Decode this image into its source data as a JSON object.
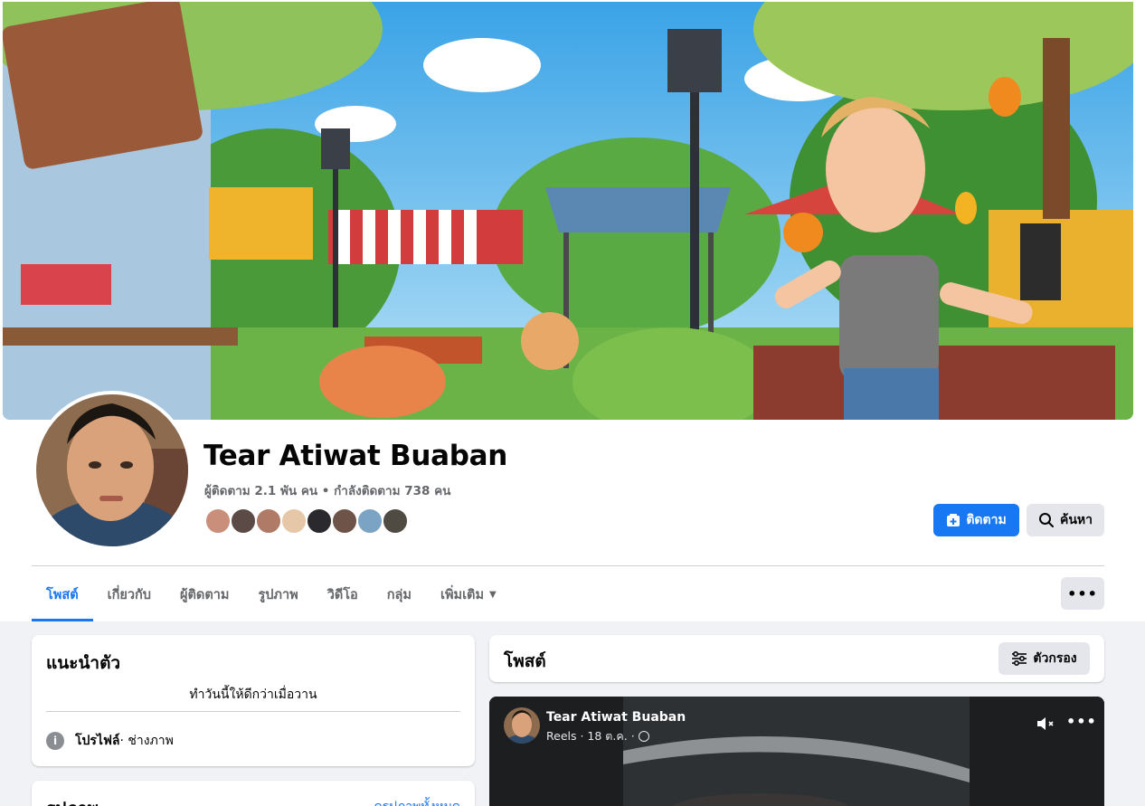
{
  "profile": {
    "name": "Tear Atiwat Buaban",
    "stats": "ผู้ติดตาม 2.1 พัน คน • กำลังติดตาม 738 คน",
    "follow_label": "ติดตาม",
    "search_label": "ค้นหา"
  },
  "tabs": [
    {
      "label": "โพสต์"
    },
    {
      "label": "เกี่ยวกับ"
    },
    {
      "label": "ผู้ติดตาม"
    },
    {
      "label": "รูปภาพ"
    },
    {
      "label": "วิดีโอ"
    },
    {
      "label": "กลุ่ม"
    },
    {
      "label": "เพิ่มเติม"
    }
  ],
  "more_menu_label": "•••",
  "intro": {
    "title": "แนะนำตัว",
    "bio": "ทำวันนี้ให้ดีกว่าเมื่อวาน",
    "info_label": "โปรไฟล์",
    "info_detail": " · ช่างภาพ"
  },
  "photos": {
    "title": "รูปภาพ",
    "see_all": "ดูรูปภาพทั้งหมด"
  },
  "posts": {
    "title": "โพสต์",
    "filter_label": "ตัวกรอง"
  },
  "reel": {
    "author": "Tear Atiwat Buaban",
    "meta": "Reels · 18 ต.ค. ·",
    "more": "•••"
  },
  "colors": {
    "accent": "#1877f2",
    "secondary_button": "#e4e6eb",
    "page_bg": "#f0f2f5",
    "muted_text": "#65676b"
  },
  "icons": [
    "follow-icon",
    "search-icon",
    "info-icon",
    "filter-icon",
    "mute-icon",
    "globe-icon",
    "chevron-down-icon"
  ]
}
